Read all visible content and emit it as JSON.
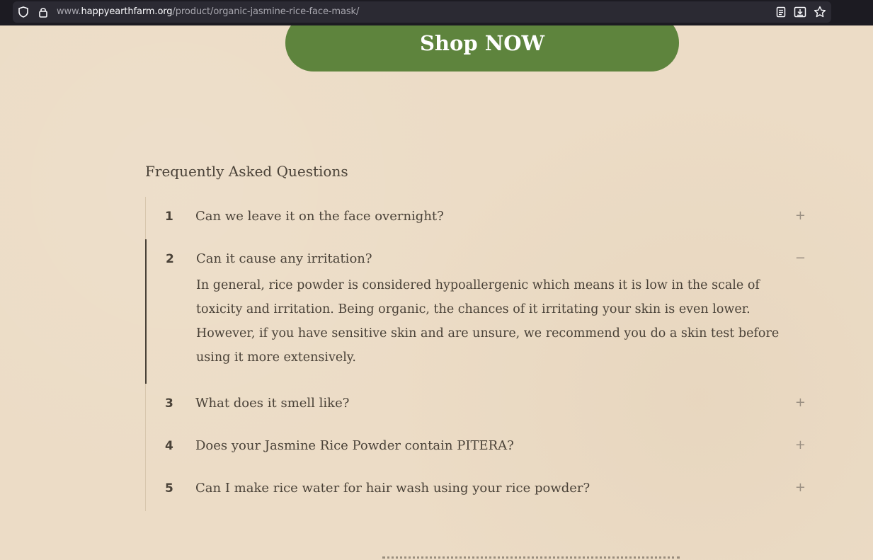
{
  "browser": {
    "url_prefix": "www.",
    "url_domain": "happyearthfarm.org",
    "url_path": "/product/organic-jasmine-rice-face-mask/"
  },
  "page": {
    "shop_button": "Shop NOW",
    "faq_heading": "Frequently Asked Questions",
    "faq": [
      {
        "num": "1",
        "question": "Can we leave it on the face overnight?",
        "toggle": "+",
        "open": false
      },
      {
        "num": "2",
        "question": "Can it cause any irritation?",
        "toggle": "−",
        "open": true,
        "answer": "In general, rice powder is considered hypoallergenic which means it is low in the scale of toxicity and irritation. Being organic, the chances of it irritating your skin is even lower. However, if you have sensitive skin and are unsure, we recommend you do a skin test before using it more extensively."
      },
      {
        "num": "3",
        "question": "What does it smell like?",
        "toggle": "+",
        "open": false
      },
      {
        "num": "4",
        "question": "Does your Jasmine Rice Powder contain PITERA?",
        "toggle": "+",
        "open": false
      },
      {
        "num": "5",
        "question": "Can I make rice water for hair wash using your rice powder?",
        "toggle": "+",
        "open": false
      }
    ]
  },
  "colors": {
    "background": "#ecdcc6",
    "button": "#5e843d",
    "text": "#4a4238"
  }
}
